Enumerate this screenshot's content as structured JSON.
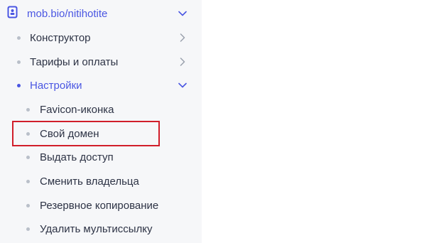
{
  "site": {
    "label": "mob.bio/nitihotite",
    "icon": "phone-icon"
  },
  "menu": [
    {
      "label": "Конструктор",
      "expanded": false
    },
    {
      "label": "Тарифы и оплаты",
      "expanded": false
    },
    {
      "label": "Настройки",
      "expanded": true,
      "active": true,
      "children": [
        {
          "label": "Favicon-иконка"
        },
        {
          "label": "Свой домен",
          "highlighted": true
        },
        {
          "label": "Выдать доступ"
        },
        {
          "label": "Сменить владельца"
        },
        {
          "label": "Резервное копирование"
        },
        {
          "label": "Удалить мультиссылку"
        }
      ]
    }
  ],
  "colors": {
    "accent": "#4a56e2",
    "highlight_border": "#d11e2a",
    "sidebar_bg": "#f6f7f9",
    "text": "#2d3345"
  }
}
